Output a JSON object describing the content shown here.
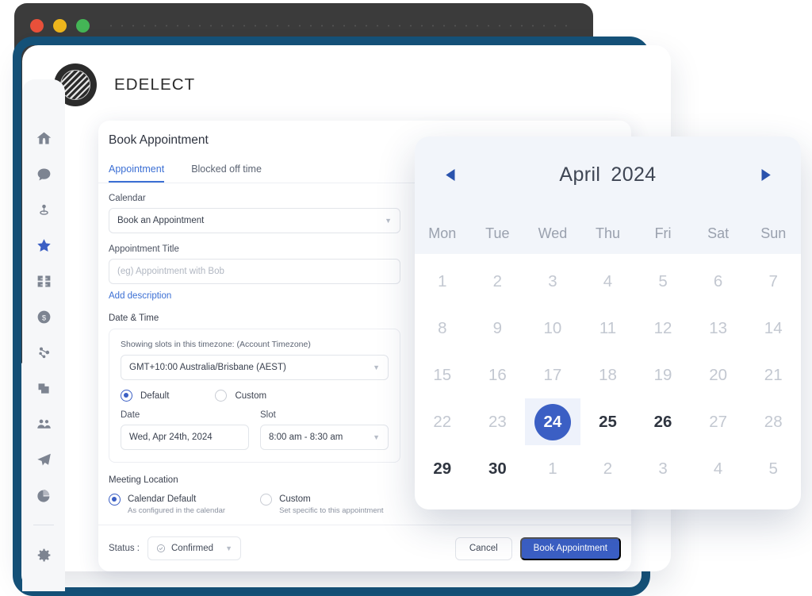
{
  "window_chrome": {
    "dots": [
      "close-red",
      "minimize-yellow",
      "maximize-green"
    ]
  },
  "brand": {
    "name": "EDELECT",
    "logo_icon": "striped-disc-logo"
  },
  "sidebar": {
    "items": [
      {
        "icon": "home-icon",
        "name": "sidebar-item-home",
        "active": false
      },
      {
        "icon": "chat-bubble-icon",
        "name": "sidebar-item-conversations",
        "active": false
      },
      {
        "icon": "location-pin-icon",
        "name": "sidebar-item-opportunities",
        "active": false
      },
      {
        "icon": "star-icon",
        "name": "sidebar-item-calendars",
        "active": true
      },
      {
        "icon": "contacts-grid-icon",
        "name": "sidebar-item-contacts",
        "active": false
      },
      {
        "icon": "dollar-coin-icon",
        "name": "sidebar-item-payments",
        "active": false
      },
      {
        "icon": "automation-nodes-icon",
        "name": "sidebar-item-automation",
        "active": false
      },
      {
        "icon": "layers-icon",
        "name": "sidebar-item-sites",
        "active": false
      },
      {
        "icon": "memberships-people-icon",
        "name": "sidebar-item-memberships",
        "active": false
      },
      {
        "icon": "paper-plane-icon",
        "name": "sidebar-item-marketing",
        "active": false
      },
      {
        "icon": "pie-chart-icon",
        "name": "sidebar-item-reporting",
        "active": false
      },
      {
        "icon": "gear-icon",
        "name": "sidebar-item-settings",
        "active": false
      }
    ]
  },
  "form": {
    "title": "Book Appointment",
    "close_label": "×",
    "tabs": [
      {
        "label": "Appointment",
        "active": true
      },
      {
        "label": "Blocked off time",
        "active": false
      }
    ],
    "calendar_field": {
      "label": "Calendar",
      "value": "Book an Appointment"
    },
    "appointment_title_field": {
      "label": "Appointment Title",
      "placeholder": "(eg) Appointment with Bob",
      "value": ""
    },
    "add_description_link": "Add description",
    "date_time": {
      "section_label": "Date & Time",
      "timezone_hint": "Showing slots in this timezone: (Account Timezone)",
      "timezone_value": "GMT+10:00 Australia/Brisbane (AEST)",
      "mode_default": "Default",
      "mode_custom": "Custom",
      "date_label": "Date",
      "date_value": "Wed, Apr 24th, 2024",
      "slot_label": "Slot",
      "slot_value": "8:00 am - 8:30 am"
    },
    "meeting_location": {
      "section_label": "Meeting Location",
      "options": [
        {
          "title": "Calendar Default",
          "subtitle": "As configured in the calendar",
          "selected": true
        },
        {
          "title": "Custom",
          "subtitle": "Set specific to this appointment",
          "selected": false
        }
      ]
    },
    "footer": {
      "status_label": "Status :",
      "status_value": "Confirmed",
      "status_icon": "check-circle-icon",
      "cancel_label": "Cancel",
      "submit_label": "Book Appointment"
    }
  },
  "datepicker": {
    "prev_icon": "triangle-left-icon",
    "next_icon": "triangle-right-icon",
    "month": "April",
    "year": "2024",
    "weekdays": [
      "Mon",
      "Tue",
      "Wed",
      "Thu",
      "Fri",
      "Sat",
      "Sun"
    ],
    "days": [
      {
        "d": "1",
        "state": "muted"
      },
      {
        "d": "2",
        "state": "muted"
      },
      {
        "d": "3",
        "state": "muted"
      },
      {
        "d": "4",
        "state": "muted"
      },
      {
        "d": "5",
        "state": "muted"
      },
      {
        "d": "6",
        "state": "muted"
      },
      {
        "d": "7",
        "state": "muted"
      },
      {
        "d": "8",
        "state": "muted"
      },
      {
        "d": "9",
        "state": "muted"
      },
      {
        "d": "10",
        "state": "muted"
      },
      {
        "d": "11",
        "state": "muted"
      },
      {
        "d": "12",
        "state": "muted"
      },
      {
        "d": "13",
        "state": "muted"
      },
      {
        "d": "14",
        "state": "muted"
      },
      {
        "d": "15",
        "state": "muted"
      },
      {
        "d": "16",
        "state": "muted"
      },
      {
        "d": "17",
        "state": "muted"
      },
      {
        "d": "18",
        "state": "muted"
      },
      {
        "d": "19",
        "state": "muted"
      },
      {
        "d": "20",
        "state": "muted"
      },
      {
        "d": "21",
        "state": "muted"
      },
      {
        "d": "22",
        "state": "muted"
      },
      {
        "d": "23",
        "state": "muted"
      },
      {
        "d": "24",
        "state": "selected"
      },
      {
        "d": "25",
        "state": "available"
      },
      {
        "d": "26",
        "state": "available"
      },
      {
        "d": "27",
        "state": "muted"
      },
      {
        "d": "28",
        "state": "muted"
      },
      {
        "d": "29",
        "state": "available"
      },
      {
        "d": "30",
        "state": "available"
      },
      {
        "d": "1",
        "state": "muted"
      },
      {
        "d": "2",
        "state": "muted"
      },
      {
        "d": "3",
        "state": "muted"
      },
      {
        "d": "4",
        "state": "muted"
      },
      {
        "d": "5",
        "state": "muted"
      }
    ],
    "selected_day": "24"
  },
  "colors": {
    "accent_blue": "#3b5fc4",
    "link_blue": "#3b6fd4",
    "frame_teal": "#155279",
    "chrome_dark": "#3b3b3b",
    "dot_red": "#e8503a",
    "dot_yellow": "#edb51c",
    "dot_green": "#44b556",
    "cal_header_bg": "#f2f5fa",
    "rail_bg": "#f6f7f9"
  }
}
